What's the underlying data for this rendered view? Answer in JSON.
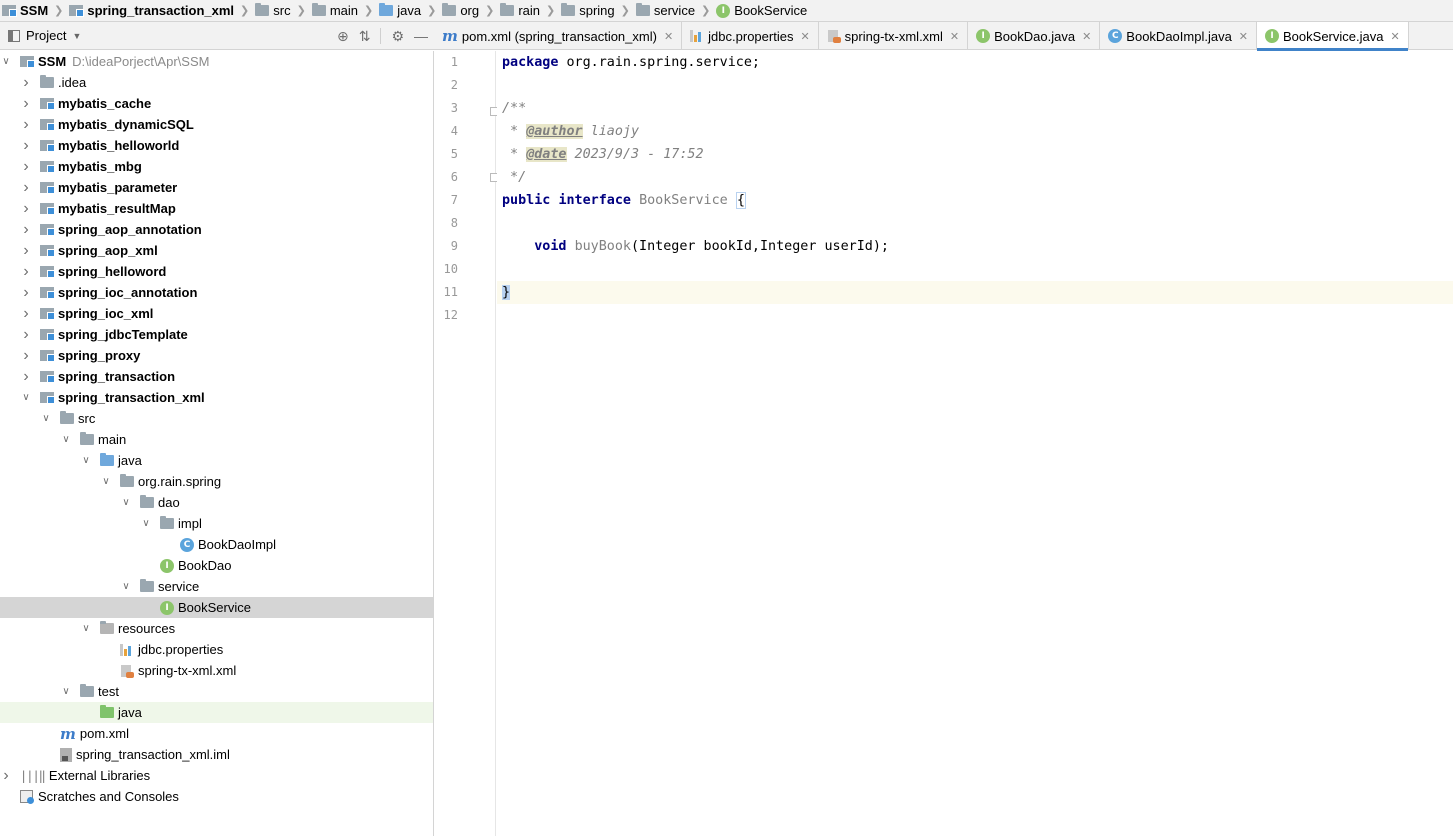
{
  "breadcrumb": [
    {
      "label": "SSM",
      "icon": "module-icon",
      "bold": true
    },
    {
      "label": "spring_transaction_xml",
      "icon": "module-icon",
      "bold": true
    },
    {
      "label": "src",
      "icon": "folder-icon"
    },
    {
      "label": "main",
      "icon": "folder-icon"
    },
    {
      "label": "java",
      "icon": "source-folder-icon"
    },
    {
      "label": "org",
      "icon": "package-icon"
    },
    {
      "label": "rain",
      "icon": "package-icon"
    },
    {
      "label": "spring",
      "icon": "package-icon"
    },
    {
      "label": "service",
      "icon": "package-icon"
    },
    {
      "label": "BookService",
      "icon": "interface-icon"
    }
  ],
  "project_panel": {
    "title": "Project",
    "tools": [
      "locate-icon",
      "collapse-all-icon",
      "gear-icon",
      "hide-icon"
    ]
  },
  "tree": [
    {
      "label": "SSM",
      "path": "D:\\ideaPorject\\Apr\\SSM",
      "depth": 0,
      "arrow": "down",
      "icon": "module",
      "bold": true
    },
    {
      "label": ".idea",
      "depth": 1,
      "arrow": "right",
      "icon": "folder"
    },
    {
      "label": "mybatis_cache",
      "depth": 1,
      "arrow": "right",
      "icon": "module",
      "bold": true
    },
    {
      "label": "mybatis_dynamicSQL",
      "depth": 1,
      "arrow": "right",
      "icon": "module",
      "bold": true
    },
    {
      "label": "mybatis_helloworld",
      "depth": 1,
      "arrow": "right",
      "icon": "module",
      "bold": true
    },
    {
      "label": "mybatis_mbg",
      "depth": 1,
      "arrow": "right",
      "icon": "module",
      "bold": true
    },
    {
      "label": "mybatis_parameter",
      "depth": 1,
      "arrow": "right",
      "icon": "module",
      "bold": true
    },
    {
      "label": "mybatis_resultMap",
      "depth": 1,
      "arrow": "right",
      "icon": "module",
      "bold": true
    },
    {
      "label": "spring_aop_annotation",
      "depth": 1,
      "arrow": "right",
      "icon": "module",
      "bold": true
    },
    {
      "label": "spring_aop_xml",
      "depth": 1,
      "arrow": "right",
      "icon": "module",
      "bold": true
    },
    {
      "label": "spring_helloword",
      "depth": 1,
      "arrow": "right",
      "icon": "module",
      "bold": true
    },
    {
      "label": "spring_ioc_annotation",
      "depth": 1,
      "arrow": "right",
      "icon": "module",
      "bold": true
    },
    {
      "label": "spring_ioc_xml",
      "depth": 1,
      "arrow": "right",
      "icon": "module",
      "bold": true
    },
    {
      "label": "spring_jdbcTemplate",
      "depth": 1,
      "arrow": "right",
      "icon": "module",
      "bold": true
    },
    {
      "label": "spring_proxy",
      "depth": 1,
      "arrow": "right",
      "icon": "module",
      "bold": true
    },
    {
      "label": "spring_transaction",
      "depth": 1,
      "arrow": "right",
      "icon": "module",
      "bold": true
    },
    {
      "label": "spring_transaction_xml",
      "depth": 1,
      "arrow": "down",
      "icon": "module",
      "bold": true
    },
    {
      "label": "src",
      "depth": 2,
      "arrow": "down",
      "icon": "folder"
    },
    {
      "label": "main",
      "depth": 3,
      "arrow": "down",
      "icon": "folder"
    },
    {
      "label": "java",
      "depth": 4,
      "arrow": "down",
      "icon": "source-folder"
    },
    {
      "label": "org.rain.spring",
      "depth": 5,
      "arrow": "down",
      "icon": "package"
    },
    {
      "label": "dao",
      "depth": 6,
      "arrow": "down",
      "icon": "package"
    },
    {
      "label": "impl",
      "depth": 7,
      "arrow": "down",
      "icon": "package"
    },
    {
      "label": "BookDaoImpl",
      "depth": 8,
      "arrow": "none",
      "icon": "class"
    },
    {
      "label": "BookDao",
      "depth": 7,
      "arrow": "none",
      "icon": "interface"
    },
    {
      "label": "service",
      "depth": 6,
      "arrow": "down",
      "icon": "package"
    },
    {
      "label": "BookService",
      "depth": 7,
      "arrow": "none",
      "icon": "interface",
      "selected": true
    },
    {
      "label": "resources",
      "depth": 4,
      "arrow": "down",
      "icon": "resources"
    },
    {
      "label": "jdbc.properties",
      "depth": 5,
      "arrow": "none",
      "icon": "properties"
    },
    {
      "label": "spring-tx-xml.xml",
      "depth": 5,
      "arrow": "none",
      "icon": "xml"
    },
    {
      "label": "test",
      "depth": 3,
      "arrow": "down",
      "icon": "folder"
    },
    {
      "label": "java",
      "depth": 4,
      "arrow": "none",
      "icon": "test-folder",
      "highlight": true
    },
    {
      "label": "pom.xml",
      "depth": 2,
      "arrow": "none",
      "icon": "maven"
    },
    {
      "label": "spring_transaction_xml.iml",
      "depth": 2,
      "arrow": "none",
      "icon": "iml"
    },
    {
      "label": "External Libraries",
      "depth": 0,
      "arrow": "right",
      "icon": "library"
    },
    {
      "label": "Scratches and Consoles",
      "depth": 0,
      "arrow": "none",
      "icon": "scratch"
    }
  ],
  "tabs": [
    {
      "label": "pom.xml (spring_transaction_xml)",
      "icon": "maven"
    },
    {
      "label": "jdbc.properties",
      "icon": "properties"
    },
    {
      "label": "spring-tx-xml.xml",
      "icon": "xml"
    },
    {
      "label": "BookDao.java",
      "icon": "interface"
    },
    {
      "label": "BookDaoImpl.java",
      "icon": "class"
    },
    {
      "label": "BookService.java",
      "icon": "interface",
      "active": true
    }
  ],
  "editor": {
    "line_numbers": [
      "1",
      "2",
      "3",
      "4",
      "5",
      "6",
      "7",
      "8",
      "9",
      "10",
      "11",
      "12"
    ],
    "code": {
      "l1_kw": "package",
      "l1_rest": " org.rain.spring.service;",
      "l3": "/**",
      "l4_pre": " * ",
      "l4_tag": "@author",
      "l4_val": " liaojy",
      "l5_pre": " * ",
      "l5_tag": "@date",
      "l5_val": " 2023/9/3 - 17:52",
      "l6": " */",
      "l7_kw1": "public",
      "l7_kw2": "interface",
      "l7_name": "BookService",
      "l7_brace": "{",
      "l9_kw": "void",
      "l9_name": "buyBook",
      "l9_rest": "(Integer bookId,Integer userId);",
      "l11_brace": "}"
    }
  },
  "colors": {
    "keyword": "#000080",
    "comment": "#808080",
    "selection": "#d5d5d5",
    "active_tab_underline": "#4083c9",
    "current_line": "#fcfaed"
  }
}
